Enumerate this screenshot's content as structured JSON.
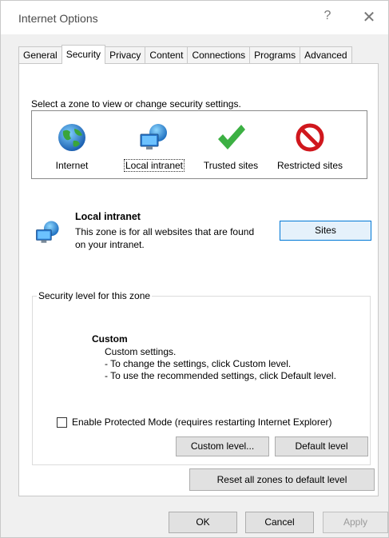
{
  "window": {
    "title": "Internet Options",
    "help_glyph": "?",
    "close_glyph": "✕"
  },
  "tabs": [
    {
      "label": "General"
    },
    {
      "label": "Security",
      "active": true
    },
    {
      "label": "Privacy"
    },
    {
      "label": "Content"
    },
    {
      "label": "Connections"
    },
    {
      "label": "Programs"
    },
    {
      "label": "Advanced"
    }
  ],
  "security": {
    "zone_prompt": "Select a zone to view or change security settings.",
    "zones": [
      {
        "label": "Internet",
        "icon": "globe-icon"
      },
      {
        "label": "Local intranet",
        "icon": "intranet-icon",
        "selected": true
      },
      {
        "label": "Trusted sites",
        "icon": "checkmark-icon"
      },
      {
        "label": "Restricted sites",
        "icon": "prohibited-icon"
      }
    ],
    "selected_zone": {
      "name": "Local intranet",
      "description": "This zone is for all websites that are found on your intranet."
    },
    "sites_button": "Sites",
    "level_group_label": "Security level for this zone",
    "level_name": "Custom",
    "level_lines": [
      "Custom settings.",
      "- To change the settings, click Custom level.",
      "- To use the recommended settings, click Default level."
    ],
    "protected_mode_label": "Enable Protected Mode (requires restarting Internet Explorer)",
    "protected_mode_checked": false,
    "custom_level_button": "Custom level...",
    "default_level_button": "Default level",
    "reset_all_button": "Reset all zones to default level"
  },
  "footer": {
    "ok": "OK",
    "cancel": "Cancel",
    "apply": "Apply"
  },
  "colors": {
    "accent": "#0078d7",
    "panel_bg": "#f0f0f0",
    "check_green": "#3cb043",
    "prohibited_red": "#d0171d"
  }
}
